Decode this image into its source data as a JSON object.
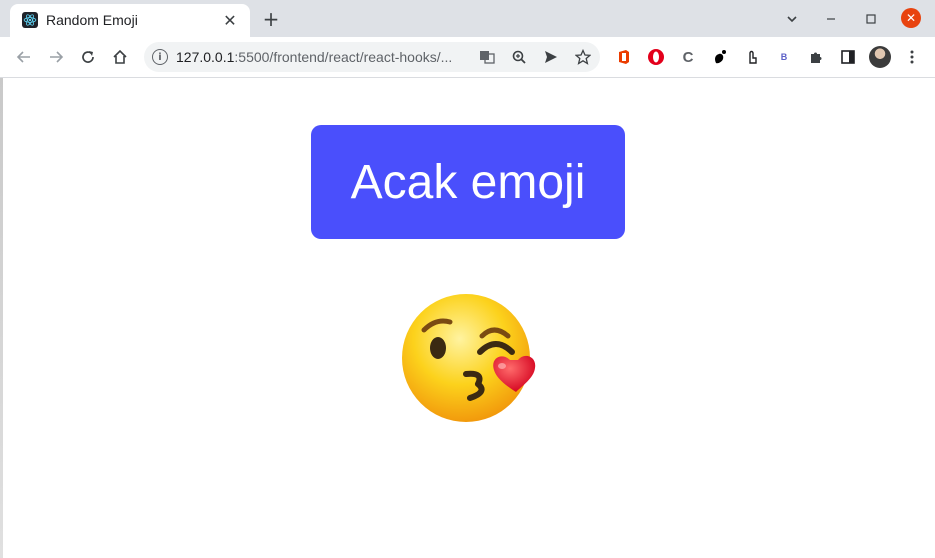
{
  "browser": {
    "tab": {
      "title": "Random Emoji",
      "favicon": "react-icon"
    },
    "address_bar": {
      "url_host": "127.0.0.1",
      "url_path": ":5500/frontend/react/react-hooks/..."
    },
    "extensions": [
      "office-icon",
      "opera-icon",
      "c-icon",
      "gnome-icon",
      "touch-icon",
      "b-icon",
      "puzzle-icon",
      "sidepanel-icon"
    ]
  },
  "page": {
    "button_label": "Acak emoji",
    "emoji": "face-blowing-a-kiss",
    "colors": {
      "button": "#4a4ffc",
      "button_text": "#ffffff"
    }
  }
}
